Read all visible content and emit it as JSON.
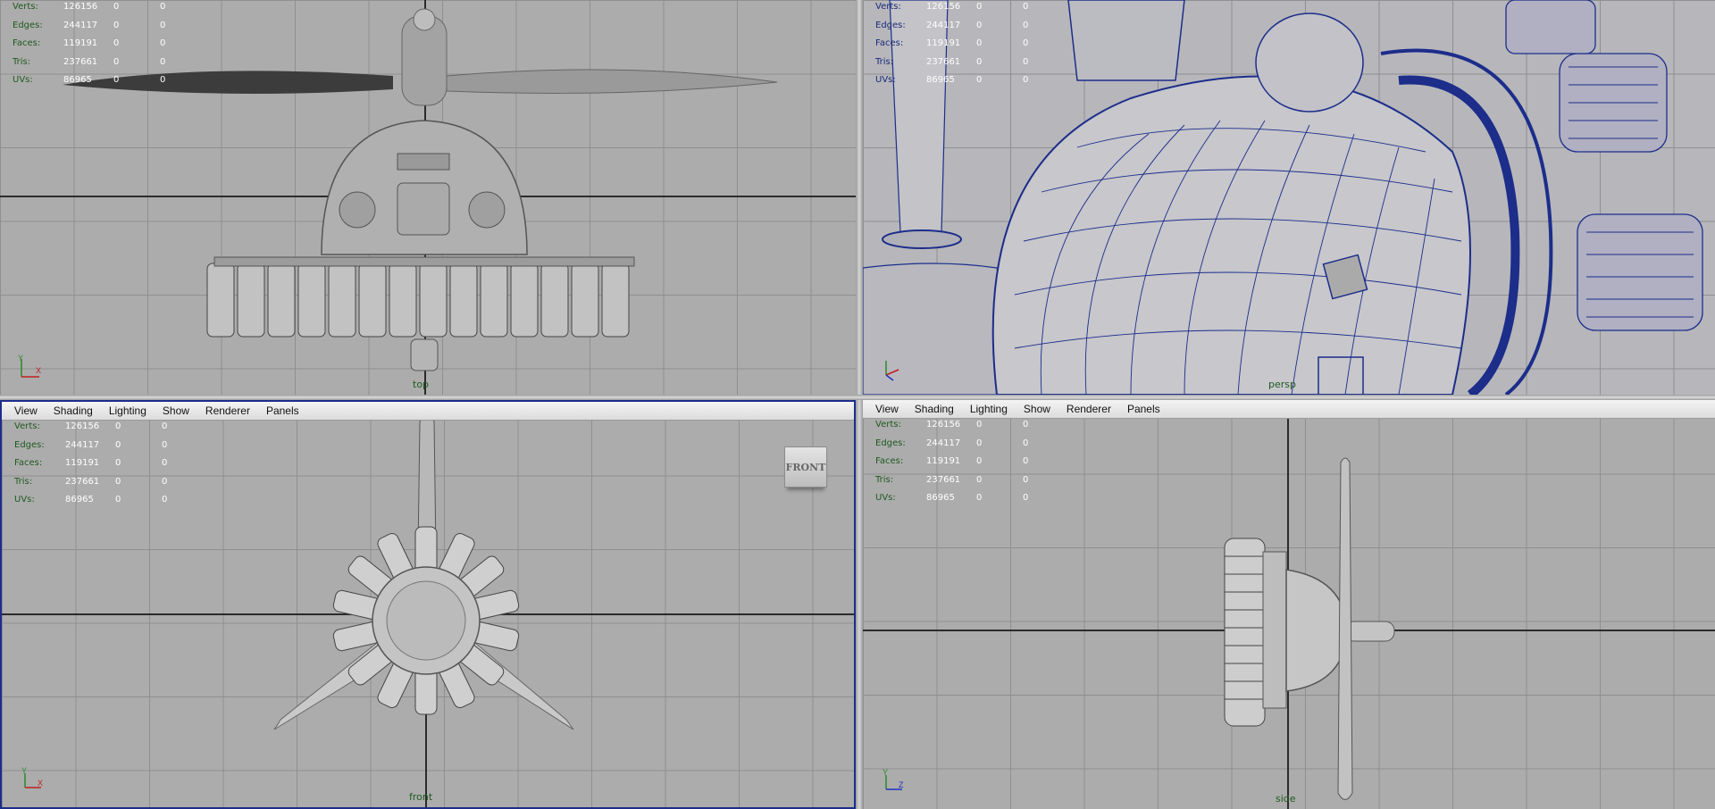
{
  "stats_labels": [
    "Verts:",
    "Edges:",
    "Faces:",
    "Tris:",
    "UVs:"
  ],
  "panel_menu": [
    "View",
    "Shading",
    "Lighting",
    "Show",
    "Renderer",
    "Panels"
  ],
  "viewports": {
    "top": {
      "camera": "top",
      "stats": [
        [
          "126156",
          "0",
          "0"
        ],
        [
          "244117",
          "0",
          "0"
        ],
        [
          "119191",
          "0",
          "0"
        ],
        [
          "237661",
          "0",
          "0"
        ],
        [
          "86965",
          "0",
          "0"
        ]
      ]
    },
    "persp": {
      "camera": "persp",
      "stats": [
        [
          "126156",
          "0",
          "0"
        ],
        [
          "244117",
          "0",
          "0"
        ],
        [
          "119191",
          "0",
          "0"
        ],
        [
          "237661",
          "0",
          "0"
        ],
        [
          "86965",
          "0",
          "0"
        ]
      ]
    },
    "front": {
      "camera": "front",
      "viewcube": "FRONT",
      "stats": [
        [
          "126156",
          "0",
          "0"
        ],
        [
          "244117",
          "0",
          "0"
        ],
        [
          "119191",
          "0",
          "0"
        ],
        [
          "237661",
          "0",
          "0"
        ],
        [
          "86965",
          "0",
          "0"
        ]
      ]
    },
    "side": {
      "camera": "side",
      "stats": [
        [
          "126156",
          "0",
          "0"
        ],
        [
          "244117",
          "0",
          "0"
        ],
        [
          "119191",
          "0",
          "0"
        ],
        [
          "237661",
          "0",
          "0"
        ],
        [
          "86965",
          "0",
          "0"
        ]
      ]
    }
  },
  "colors": {
    "viewport_bg": "#acacac",
    "grid_line": "#8f8f8f",
    "grid_axis": "#2b2b2b",
    "wireframe": "#1c2d8a",
    "active_border": "#1c2d8a"
  },
  "icons": [
    "axis-gizmo-icon",
    "viewcube-icon"
  ]
}
